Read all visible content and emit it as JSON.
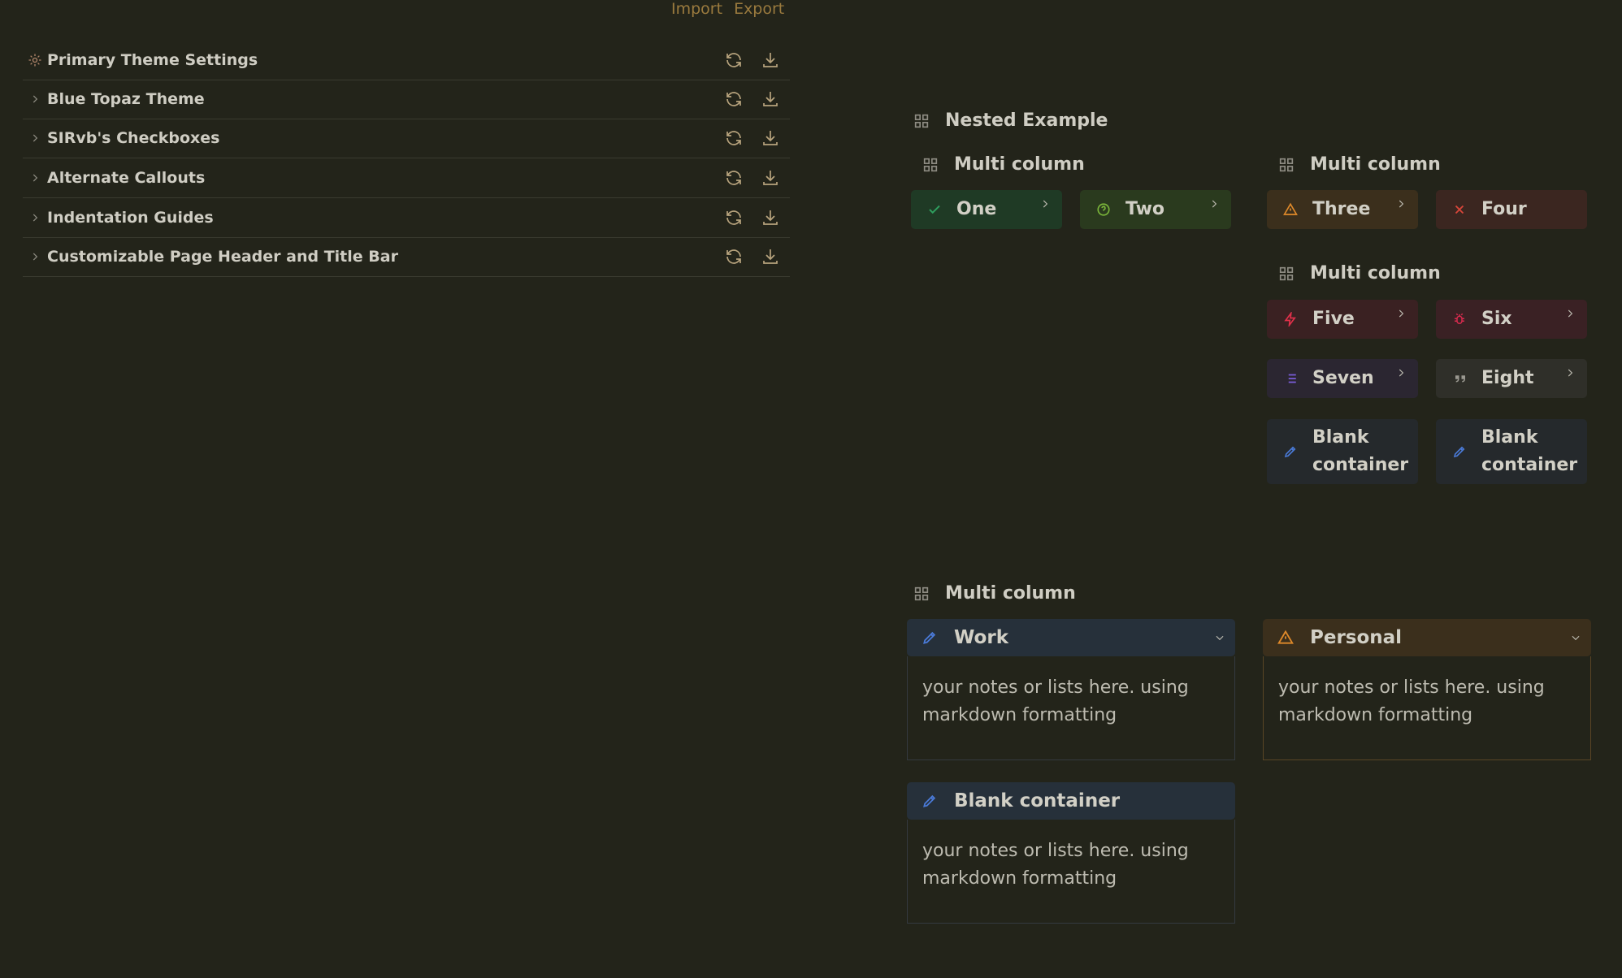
{
  "top_links": {
    "import": "Import",
    "export": "Export"
  },
  "settings_rows": [
    {
      "label": "Primary Theme Settings",
      "lead_icon": "palette-icon"
    },
    {
      "label": "Blue Topaz Theme",
      "lead_icon": "chevron-right-icon"
    },
    {
      "label": "SIRvb's Checkboxes",
      "lead_icon": "chevron-right-icon"
    },
    {
      "label": "Alternate Callouts",
      "lead_icon": "chevron-right-icon"
    },
    {
      "label": "Indentation Guides",
      "lead_icon": "chevron-right-icon"
    },
    {
      "label": "Customizable Page Header and Title Bar",
      "lead_icon": "chevron-right-icon"
    }
  ],
  "nested": {
    "title": "Nested Example",
    "col1_title": "Multi column",
    "col2_title": "Multi column",
    "col3_title": "Multi column",
    "callouts": {
      "one": "One",
      "two": "Two",
      "three": "Three",
      "four": "Four",
      "five": "Five",
      "six": "Six",
      "seven": "Seven",
      "eight": "Eight",
      "blank1_line1": "Blank",
      "blank1_line2": "container",
      "blank2_line1": "Blank",
      "blank2_line2": "container"
    }
  },
  "multi": {
    "title": "Multi column",
    "work": {
      "title": "Work",
      "body": "your notes or lists here. using markdown formatting"
    },
    "personal": {
      "title": "Personal",
      "body": "your notes or lists here. using markdown formatting"
    },
    "blank": {
      "title": "Blank container",
      "body": "your notes or lists here. using markdown formatting"
    }
  },
  "colors": {
    "background": "#23241a",
    "success": "#2f9e5e",
    "question": "#7ab53a",
    "warning": "#e08a2a",
    "error": "#d9463a",
    "danger": "#e0304a",
    "bug": "#d82a4e",
    "list": "#7a5cd8",
    "quote": "#9a9890",
    "note": "#4a7ad8"
  }
}
